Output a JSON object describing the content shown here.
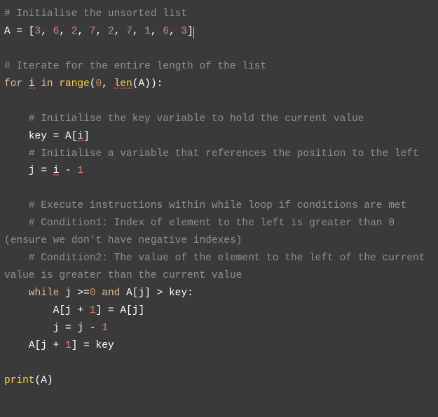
{
  "code": {
    "c1": "# Initialise the unsorted list",
    "line2_pre": "A = [",
    "line2_nums": [
      "3",
      "6",
      "2",
      "7",
      "2",
      "7",
      "1",
      "6",
      "3"
    ],
    "line2_post": "]",
    "c3": "# Iterate for the entire length of the list",
    "kw_for": "for",
    "var_i": "i",
    "kw_in": "in",
    "fn_range": "range",
    "zero": "0",
    "fn_len": "len",
    "rangeA": "A",
    "line4_tail": ")):",
    "c5": "# Initialise the key variable to hold the current value",
    "line6": "key = A[",
    "line6b": "]",
    "c7": "# Initialise a variable that references the position to the left",
    "line8a": "j = ",
    "line8b": " - ",
    "one": "1",
    "c9": "# Execute instructions within while loop if conditions are met",
    "c10": "# Condition1: Index of element to the left is greater than 0 (ensure we don't have negative indexes)",
    "c11": "# Condition2: The value of the element to the left of the current value is greater than the current value",
    "kw_while": "while",
    "while_a": " j >=",
    "while_b": " ",
    "kw_and": "and",
    "while_c": " A[j] > key:",
    "l12a": "A[j + ",
    "l12b": "] = A[j]",
    "l13a": "j = j - ",
    "l14a": "A[j + ",
    "l14b": "] = key",
    "fn_print": "print",
    "printA": "(A)"
  }
}
